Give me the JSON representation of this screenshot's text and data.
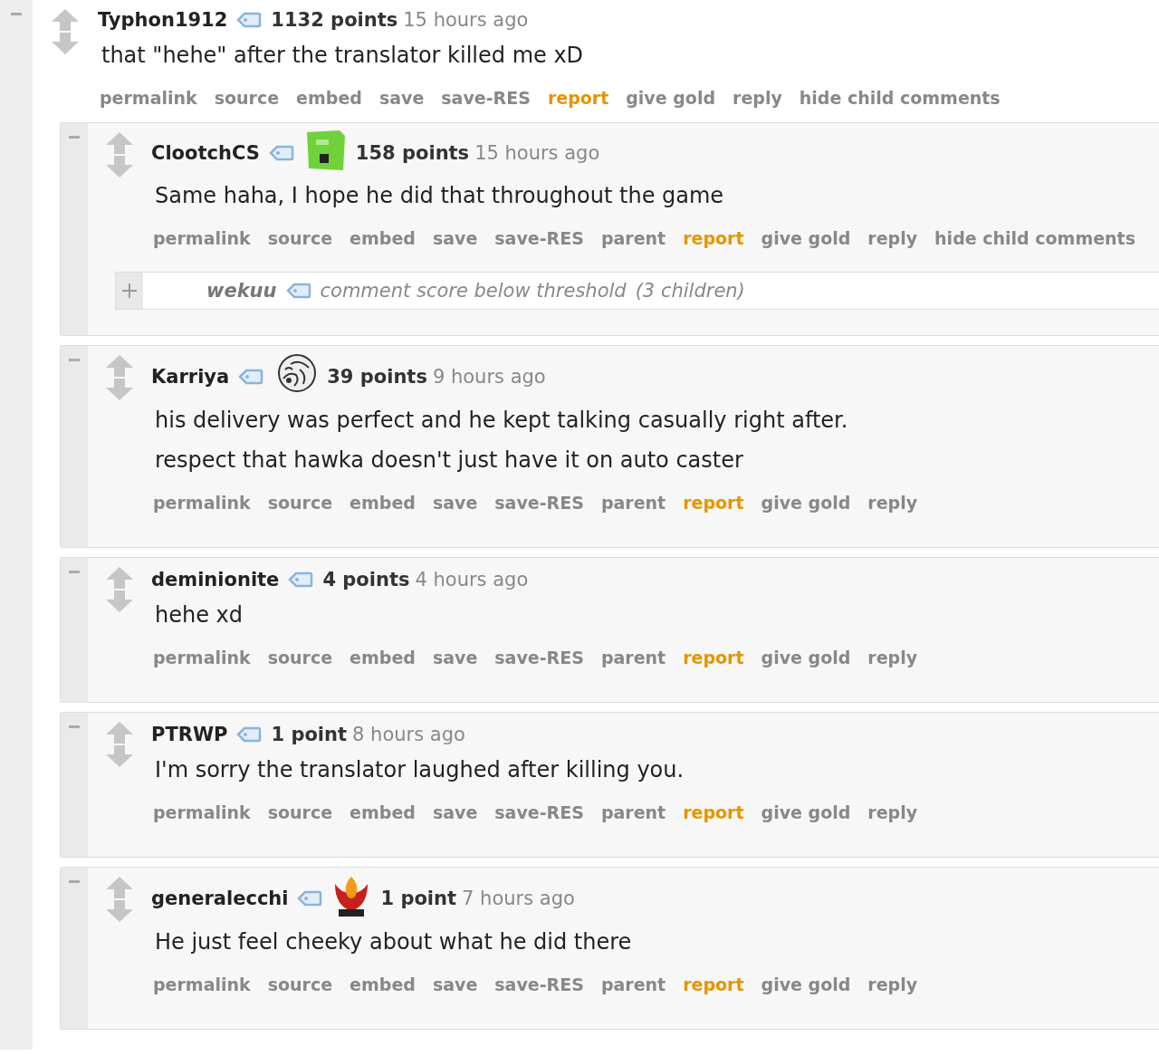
{
  "comments": [
    {
      "kind": "comment",
      "author": "Typhon1912",
      "points": "1132 points",
      "time": "15 hours ago",
      "body": [
        "that \"hehe\" after the translator killed me xD"
      ],
      "actions": [
        {
          "label": "permalink",
          "kind": "link"
        },
        {
          "label": "source",
          "kind": "link"
        },
        {
          "label": "embed",
          "kind": "link"
        },
        {
          "label": "save",
          "kind": "link"
        },
        {
          "label": "save-RES",
          "kind": "link"
        },
        {
          "label": "report",
          "kind": "report"
        },
        {
          "label": "give gold",
          "kind": "link"
        },
        {
          "label": "reply",
          "kind": "link"
        },
        {
          "label": "hide child comments",
          "kind": "link"
        }
      ],
      "children": [
        {
          "kind": "comment",
          "author": "ClootchCS",
          "flair": {
            "kind": "green"
          },
          "points": "158 points",
          "time": "15 hours ago",
          "body": [
            "Same haha, I hope he did that throughout the game"
          ],
          "actions": [
            {
              "label": "permalink",
              "kind": "link"
            },
            {
              "label": "source",
              "kind": "link"
            },
            {
              "label": "embed",
              "kind": "link"
            },
            {
              "label": "save",
              "kind": "link"
            },
            {
              "label": "save-RES",
              "kind": "link"
            },
            {
              "label": "parent",
              "kind": "link"
            },
            {
              "label": "report",
              "kind": "report"
            },
            {
              "label": "give gold",
              "kind": "link"
            },
            {
              "label": "reply",
              "kind": "link"
            },
            {
              "label": "hide child comments",
              "kind": "link"
            }
          ],
          "children": [
            {
              "kind": "collapsed",
              "author": "wekuu",
              "message": "comment score below threshold",
              "children_count": "(3 children)"
            }
          ]
        },
        {
          "kind": "comment",
          "author": "Karriya",
          "flair": {
            "kind": "lion"
          },
          "points": "39 points",
          "time": "9 hours ago",
          "body": [
            "his delivery was perfect and he kept talking casually right after.",
            "respect that hawka doesn't just have it on auto caster"
          ],
          "actions": [
            {
              "label": "permalink",
              "kind": "link"
            },
            {
              "label": "source",
              "kind": "link"
            },
            {
              "label": "embed",
              "kind": "link"
            },
            {
              "label": "save",
              "kind": "link"
            },
            {
              "label": "save-RES",
              "kind": "link"
            },
            {
              "label": "parent",
              "kind": "link"
            },
            {
              "label": "report",
              "kind": "report"
            },
            {
              "label": "give gold",
              "kind": "link"
            },
            {
              "label": "reply",
              "kind": "link"
            }
          ]
        },
        {
          "kind": "comment",
          "author": "deminionite",
          "points": "4 points",
          "time": "4 hours ago",
          "body": [
            "hehe xd"
          ],
          "actions": [
            {
              "label": "permalink",
              "kind": "link"
            },
            {
              "label": "source",
              "kind": "link"
            },
            {
              "label": "embed",
              "kind": "link"
            },
            {
              "label": "save",
              "kind": "link"
            },
            {
              "label": "save-RES",
              "kind": "link"
            },
            {
              "label": "parent",
              "kind": "link"
            },
            {
              "label": "report",
              "kind": "report"
            },
            {
              "label": "give gold",
              "kind": "link"
            },
            {
              "label": "reply",
              "kind": "link"
            }
          ]
        },
        {
          "kind": "comment",
          "author": "PTRWP",
          "points": "1 point",
          "time": "8 hours ago",
          "body": [
            "I'm sorry the translator laughed after killing you."
          ],
          "actions": [
            {
              "label": "permalink",
              "kind": "link"
            },
            {
              "label": "source",
              "kind": "link"
            },
            {
              "label": "embed",
              "kind": "link"
            },
            {
              "label": "save",
              "kind": "link"
            },
            {
              "label": "save-RES",
              "kind": "link"
            },
            {
              "label": "parent",
              "kind": "link"
            },
            {
              "label": "report",
              "kind": "report"
            },
            {
              "label": "give gold",
              "kind": "link"
            },
            {
              "label": "reply",
              "kind": "link"
            }
          ]
        },
        {
          "kind": "comment",
          "author": "generalecchi",
          "flair": {
            "kind": "phoenix"
          },
          "points": "1 point",
          "time": "7 hours ago",
          "body": [
            "He just feel cheeky about what he did there"
          ],
          "actions": [
            {
              "label": "permalink",
              "kind": "link"
            },
            {
              "label": "source",
              "kind": "link"
            },
            {
              "label": "embed",
              "kind": "link"
            },
            {
              "label": "save",
              "kind": "link"
            },
            {
              "label": "save-RES",
              "kind": "link"
            },
            {
              "label": "parent",
              "kind": "link"
            },
            {
              "label": "report",
              "kind": "report"
            },
            {
              "label": "give gold",
              "kind": "link"
            },
            {
              "label": "reply",
              "kind": "link"
            }
          ]
        }
      ]
    }
  ]
}
